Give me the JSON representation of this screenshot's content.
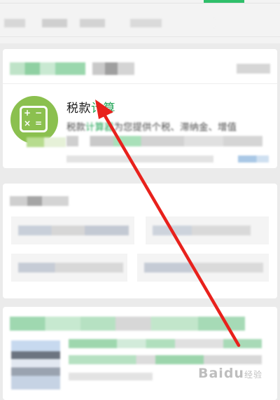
{
  "result": {
    "title_plain": "税款",
    "title_highlight": "计算",
    "desc_plain_1": "税款",
    "desc_highlight": "计算器",
    "desc_plain_2": "为您提供个税、滞纳金、增值",
    "icon": "calculator-icon"
  },
  "watermark": {
    "text": "Baidu",
    "sub": "经验"
  },
  "colors": {
    "accent_green": "#21a557",
    "icon_green": "#8bc04f",
    "arrow_red": "#e8211c",
    "background": "#ebebeb"
  }
}
